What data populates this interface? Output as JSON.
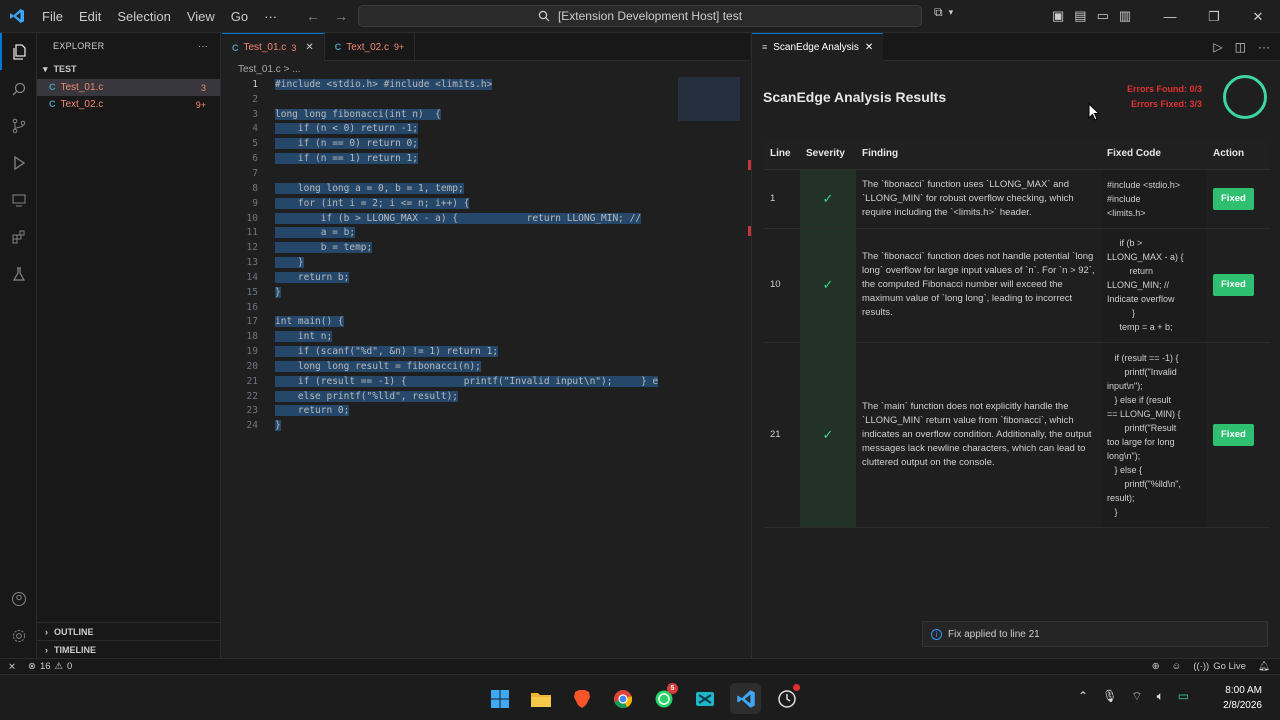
{
  "menu": [
    "File",
    "Edit",
    "Selection",
    "View",
    "Go",
    "···"
  ],
  "command_center": "[Extension Development Host] test",
  "sidebar": {
    "title": "EXPLORER",
    "folder": "TEST",
    "files": [
      {
        "icon": "C",
        "name": "Test_01.c",
        "badge": "3"
      },
      {
        "icon": "C",
        "name": "Text_02.c",
        "badge": "9+"
      }
    ],
    "outline": "OUTLINE",
    "timeline": "TIMELINE"
  },
  "editor": {
    "tabs": [
      {
        "icon": "C",
        "name": "Test_01.c",
        "count": "3"
      },
      {
        "icon": "C",
        "name": "Text_02.c",
        "count": "9+"
      }
    ],
    "breadcrumb": "Test_01.c > ...",
    "lines": [
      {
        "n": "1",
        "t": "#include <stdio.h> #include <limits.h>"
      },
      {
        "n": "2",
        "t": ""
      },
      {
        "n": "3",
        "t": "long long fibonacci(int n)  {"
      },
      {
        "n": "4",
        "t": "    if (n < 0) return -1;"
      },
      {
        "n": "5",
        "t": "    if (n == 0) return 0;"
      },
      {
        "n": "6",
        "t": "    if (n == 1) return 1;"
      },
      {
        "n": "7",
        "t": ""
      },
      {
        "n": "8",
        "t": "    long long a = 0, b = 1, temp;"
      },
      {
        "n": "9",
        "t": "    for (int i = 2; i <= n; i++) {"
      },
      {
        "n": "10",
        "t": "        if (b > LLONG_MAX - a) {            return LLONG_MIN; //"
      },
      {
        "n": "11",
        "t": "        a = b;"
      },
      {
        "n": "12",
        "t": "        b = temp;"
      },
      {
        "n": "13",
        "t": "    }"
      },
      {
        "n": "14",
        "t": "    return b;"
      },
      {
        "n": "15",
        "t": "}"
      },
      {
        "n": "16",
        "t": ""
      },
      {
        "n": "17",
        "t": "int main() {"
      },
      {
        "n": "18",
        "t": "    int n;"
      },
      {
        "n": "19",
        "t": "    if (scanf(\"%d\", &n) != 1) return 1;"
      },
      {
        "n": "20",
        "t": "    long long result = fibonacci(n);"
      },
      {
        "n": "21",
        "t": "    if (result == -1) {          printf(\"Invalid input\\n\");     } e"
      },
      {
        "n": "22",
        "t": "    else printf(\"%lld\", result);"
      },
      {
        "n": "23",
        "t": "    return 0;"
      },
      {
        "n": "24",
        "t": "}"
      }
    ]
  },
  "panel": {
    "tab_title": "ScanEdge Analysis",
    "heading": "ScanEdge Analysis Results",
    "errors_found": "Errors Found: 0/3",
    "errors_fixed": "Errors Fixed: 3/3",
    "columns": [
      "Line",
      "Severity",
      "Finding",
      "Fixed Code",
      "Action"
    ],
    "rows": [
      {
        "line": "1",
        "severity": "✓",
        "finding": "The `fibonacci` function uses `LLONG_MAX` and `LLONG_MIN` for robust overflow checking, which require including the `<limits.h>` header.",
        "fixed_code": "#include <stdio.h>\n#include\n<limits.h>",
        "action": "Fixed"
      },
      {
        "line": "10",
        "severity": "✓",
        "finding": "The `fibonacci` function does not handle potential `long long` overflow for large input values of `n`. For `n > 92`, the computed Fibonacci number will exceed the maximum value of `long long`, leading to incorrect results.",
        "fixed_code": "     if (b >\nLLONG_MAX - a) {\n         return\nLLONG_MIN; //\nIndicate overflow\n          }\n     temp = a + b;",
        "action": "Fixed"
      },
      {
        "line": "21",
        "severity": "✓",
        "finding": "The `main` function does not explicitly handle the `LLONG_MIN` return value from `fibonacci`, which indicates an overflow condition. Additionally, the output messages lack newline characters, which can lead to cluttered output on the console.",
        "fixed_code": "   if (result == -1) {\n       printf(\"Invalid\ninput\\n\");\n   } else if (result\n== LLONG_MIN) {\n       printf(\"Result\ntoo large for long\nlong\\n\");\n   } else {\n       printf(\"%lld\\n\",\nresult);\n   }",
        "action": "Fixed"
      }
    ],
    "toast": "Fix applied to line 21"
  },
  "status": {
    "problems": "16",
    "warnings": "0",
    "go_live": "Go Live"
  },
  "taskbar": {
    "time": "8:00 AM",
    "date": "2/8/2026",
    "whatsapp_badge": "5"
  }
}
